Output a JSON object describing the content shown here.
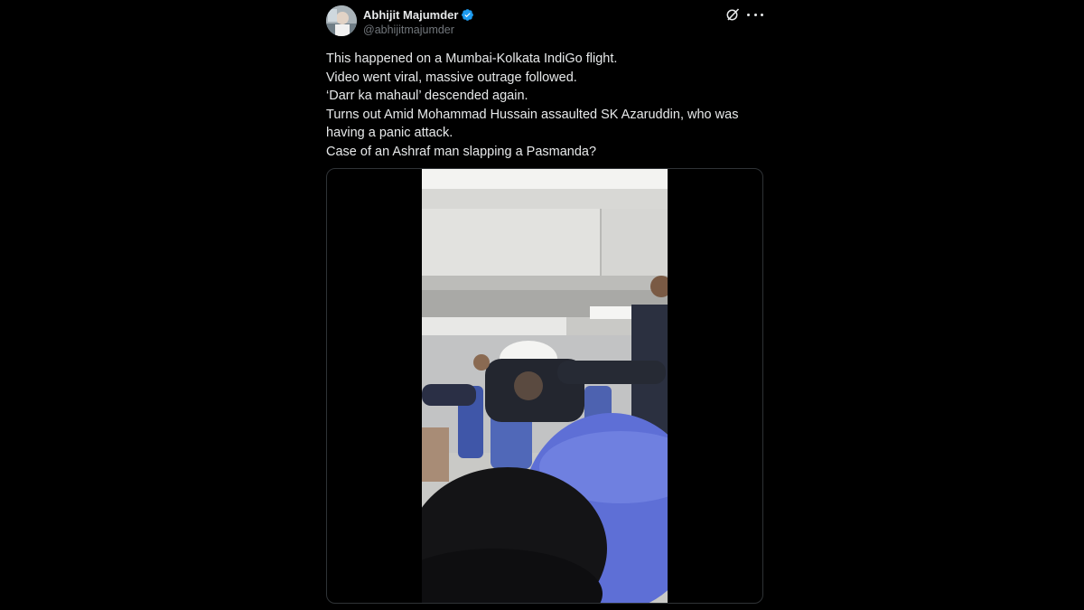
{
  "author": {
    "display_name": "Abhijit Majumder",
    "handle": "@abhijitmajumder",
    "verified": true
  },
  "icons": {
    "verified": "verified-badge-icon",
    "grok": "grok-icon",
    "more": "more-options-icon"
  },
  "post": {
    "lines": [
      "This happened on a Mumbai-Kolkata IndiGo flight.",
      "Video went viral, massive outrage followed.",
      "‘Darr ka mahaul’ descended again.",
      "Turns out Amid Mohammad Hussain assaulted SK Azaruddin, who was having a panic attack.",
      "Case of an Ashraf man slapping a Pasmanda?"
    ]
  },
  "colors": {
    "background": "#000000",
    "text": "#e7e9ea",
    "secondary_text": "#71767b",
    "verified_blue": "#1d9bf0",
    "media_border": "#2f3336"
  }
}
